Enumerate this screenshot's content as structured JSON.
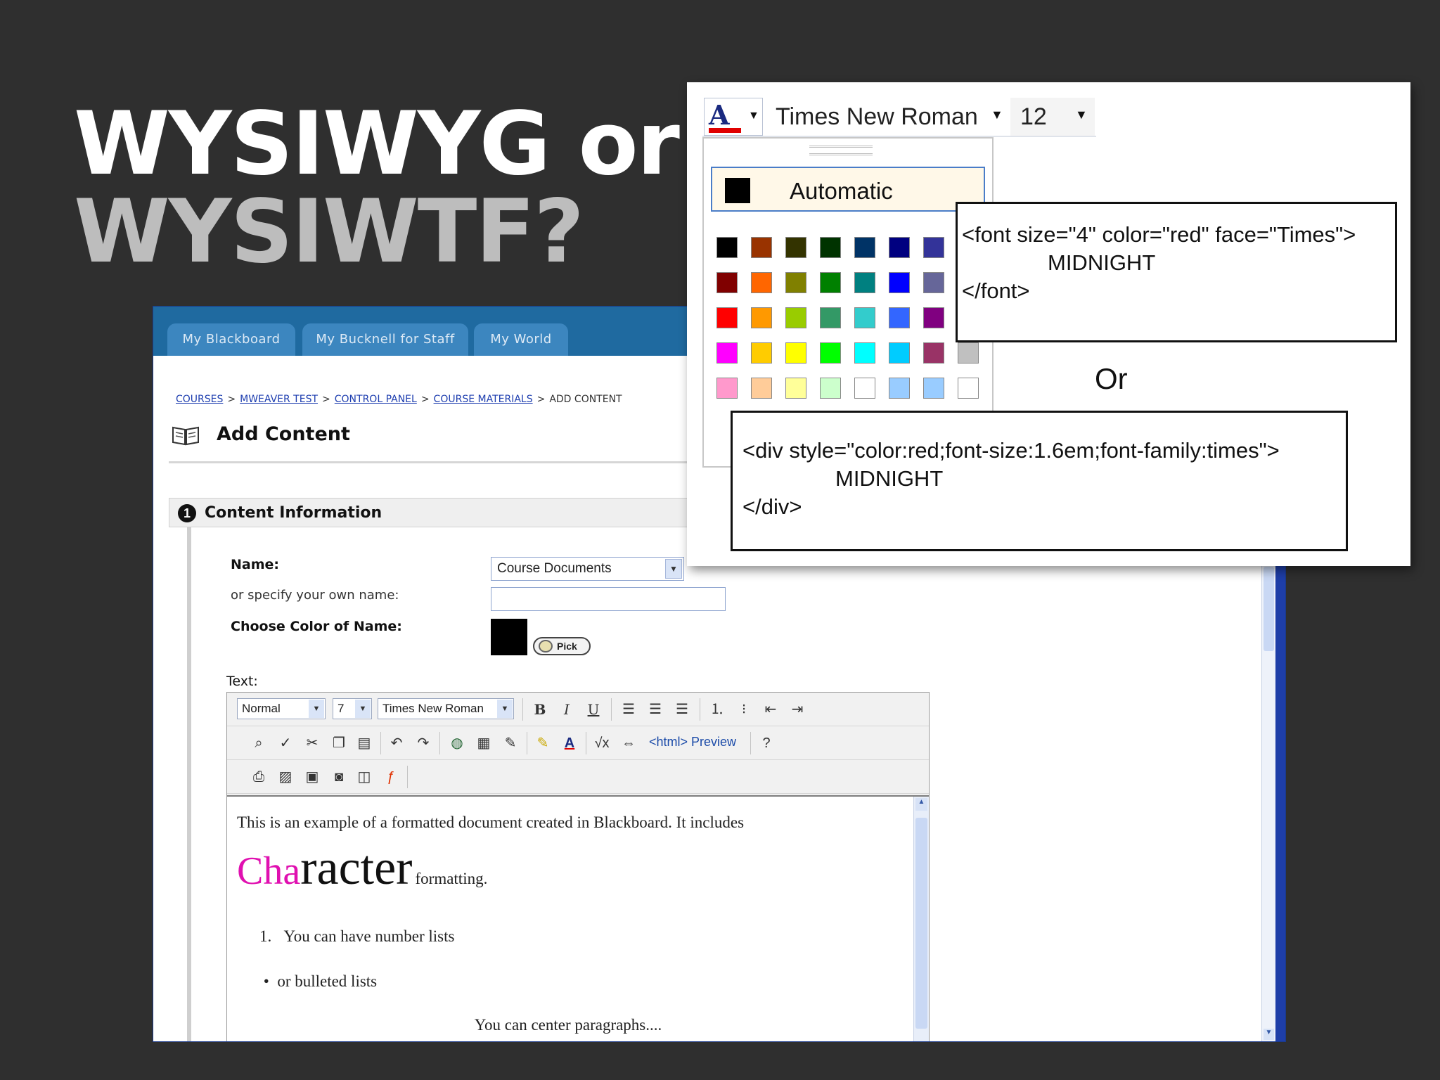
{
  "slide": {
    "title_line1": "WYSIWYG or",
    "title_line2": "WYSIWTF?",
    "background": "#2f2f2f"
  },
  "blackboard": {
    "tabs": [
      "My Blackboard",
      "My Bucknell for Staff",
      "My World"
    ],
    "breadcrumb": [
      "COURSES",
      "MWEAVER TEST",
      "CONTROL PANEL",
      "COURSE MATERIALS",
      "ADD CONTENT"
    ],
    "breadcrumb_sep": ">",
    "page_title": "Add Content",
    "page_icon": "book-icon",
    "section": {
      "number": "1",
      "title": "Content Information"
    },
    "form": {
      "name_label": "Name:",
      "name_value": "Course Documents",
      "own_name_label": "or specify your own name:",
      "own_name_value": "",
      "color_label": "Choose Color of Name:",
      "color_value": "#000000",
      "pick_label": "Pick",
      "text_label": "Text:"
    },
    "editor": {
      "style_select": "Normal",
      "size_select": "7",
      "font_select": "Times New Roman",
      "html_label": "<html>",
      "preview_label": "Preview",
      "content": {
        "line1": "This is an example of a formatted document created in Blackboard. It includes",
        "char_part1": "Cha",
        "char_part2": "racter",
        "char_part3": "formatting.",
        "numbered_marker": "1.",
        "numbered_item": "You can have number lists",
        "bullet_marker": "•",
        "bulleted_item": "or bulleted lists",
        "centered_item": "You can center paragraphs...."
      }
    }
  },
  "overlay": {
    "font_name": "Times New Roman",
    "font_size": "12",
    "automatic_label": "Automatic",
    "palette_colors": [
      [
        "#000000",
        "#993300",
        "#333300",
        "#003300",
        "#003366",
        "#000080",
        "#333399",
        "#333333"
      ],
      [
        "#800000",
        "#ff6600",
        "#808000",
        "#008000",
        "#008080",
        "#0000ff",
        "#666699",
        "#808080"
      ],
      [
        "#ff0000",
        "#ff9900",
        "#99cc00",
        "#339966",
        "#33cccc",
        "#3366ff",
        "#800080",
        "#969696"
      ],
      [
        "#ff00ff",
        "#ffcc00",
        "#ffff00",
        "#00ff00",
        "#00ffff",
        "#00ccff",
        "#993366",
        "#c0c0c0"
      ],
      [
        "#ff99cc",
        "#ffcc99",
        "#ffff99",
        "#ccffcc",
        "#ffffff",
        "#99ccff",
        "#99ccff",
        "#ffffff"
      ]
    ],
    "code1": {
      "line1": "<font size=\"4\" color=\"red\" face=\"Times\">",
      "line2": "MIDNIGHT",
      "line3": "</font>"
    },
    "or_label": "Or",
    "code2": {
      "line1": "<div style=\"color:red;font-size:1.6em;font-family:times\">",
      "line2": "MIDNIGHT",
      "line3": "</div>"
    }
  }
}
